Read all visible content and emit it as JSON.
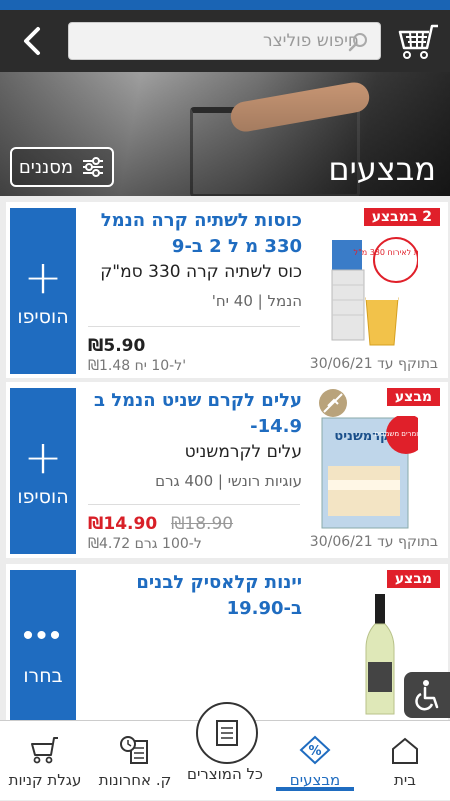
{
  "header": {
    "search_placeholder": "חיפוש פוליצר"
  },
  "hero": {
    "title": "מבצעים",
    "filter_label": "מסננים"
  },
  "products": [
    {
      "badge": "2 במבצע",
      "title": "כוסות לשתיה קרה הנמל 330 מ ל 2 ב-9",
      "description": "כוס לשתיה קרה 330 סמ\"ק",
      "meta": "הנמל | 40 יח'",
      "price": "₪5.90",
      "old_price": "",
      "unit_price": "₪1.48 ל-10 יח'",
      "valid_until": "בתוקף עד 30/06/21",
      "action_label": "הוסיפו",
      "action_icon": "plus-icon",
      "image_sticker": "נהדרות לאירוח 330 מ\"ל"
    },
    {
      "badge": "מבצע",
      "title": "עלים לקרם שניט הנמל ב 14.9-",
      "description": "עלים לקרמשניט",
      "meta": "עוגיות רונשי | 400 גרם",
      "price": "₪14.90",
      "old_price": "₪18.90",
      "unit_price": "₪4.72 ל-100 גרם",
      "valid_until": "בתוקף עד 30/06/21",
      "action_label": "הוסיפו",
      "action_icon": "plus-icon",
      "image_sticker": "ללא חומרים משמרים",
      "image_brand": "קרמשניט"
    },
    {
      "badge": "מבצע",
      "title": "יינות קלאסיק לבנים ב-19.90",
      "action_label": "בחרו",
      "action_icon": "more-dots-icon"
    }
  ],
  "bottom_nav": [
    {
      "label": "בית",
      "icon": "home-icon",
      "active": false
    },
    {
      "label": "מבצעים",
      "icon": "percent-tag-icon",
      "active": true
    },
    {
      "label": "כל המוצרים",
      "icon": "product-list-icon",
      "active": false
    },
    {
      "label": "ק. אחרונות",
      "icon": "recent-orders-icon",
      "active": false
    },
    {
      "label": "עגלת קניות",
      "icon": "shopping-cart-icon",
      "active": false
    }
  ],
  "colors": {
    "brand_blue": "#1f6cc0",
    "badge_red": "#e0202a",
    "price_red": "#d81f27",
    "top_bar": "#2c2c2c"
  }
}
